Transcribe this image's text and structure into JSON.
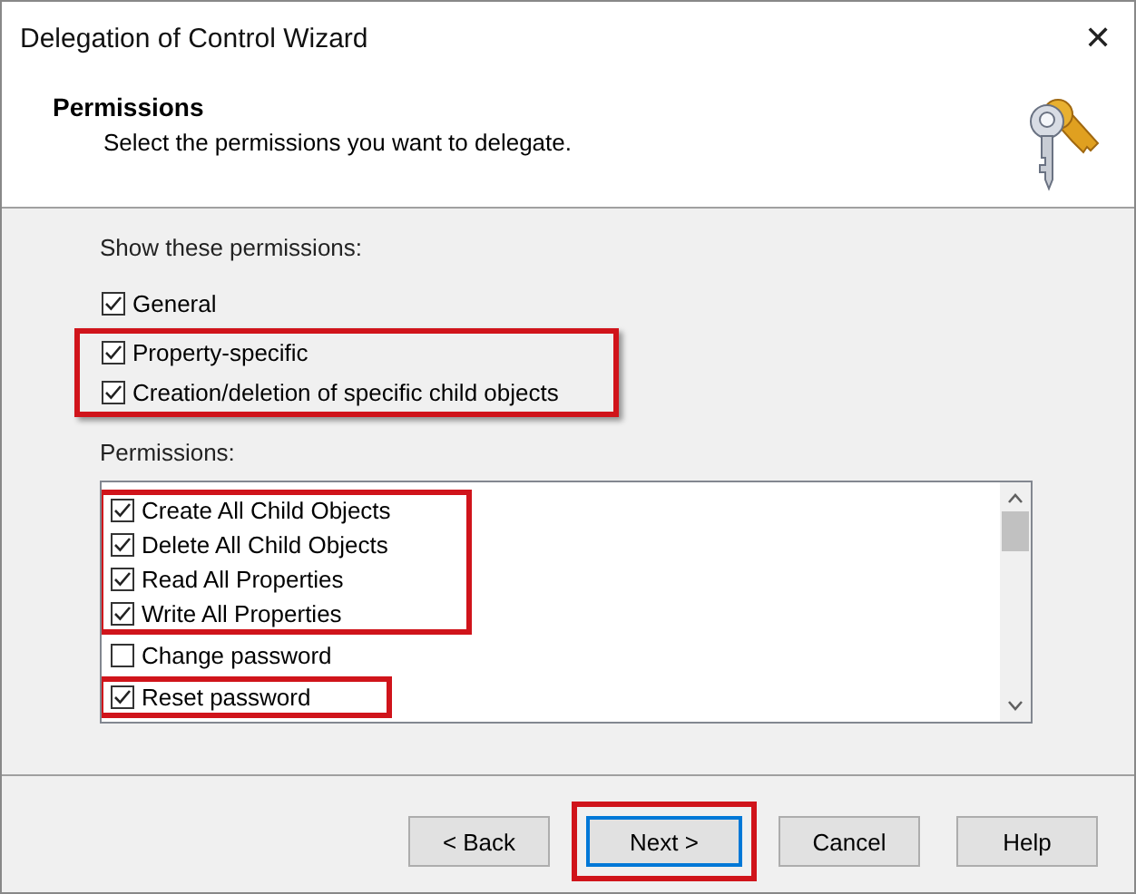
{
  "window": {
    "title": "Delegation of Control Wizard",
    "close": "✕"
  },
  "header": {
    "title": "Permissions",
    "subtitle": "Select the permissions you want to delegate."
  },
  "show_label": "Show these permissions:",
  "show_options": [
    {
      "label": "General",
      "checked": true,
      "highlighted": false
    },
    {
      "label": "Property-specific",
      "checked": true,
      "highlighted": true
    },
    {
      "label": "Creation/deletion of specific child objects",
      "checked": true,
      "highlighted": true
    }
  ],
  "permissions_label": "Permissions:",
  "permissions": [
    {
      "label": "Create All Child Objects",
      "checked": true,
      "highlighted": true
    },
    {
      "label": "Delete All Child Objects",
      "checked": true,
      "highlighted": true
    },
    {
      "label": "Read All Properties",
      "checked": true,
      "highlighted": true
    },
    {
      "label": "Write All Properties",
      "checked": true,
      "highlighted": true
    },
    {
      "label": "Change password",
      "checked": false,
      "highlighted": false
    },
    {
      "label": "Reset password",
      "checked": true,
      "highlighted": true
    }
  ],
  "buttons": [
    {
      "label": "< Back",
      "default": false,
      "highlighted": false
    },
    {
      "label": "Next >",
      "default": true,
      "highlighted": true
    },
    {
      "label": "Cancel",
      "default": false,
      "highlighted": false
    },
    {
      "label": "Help",
      "default": false,
      "highlighted": false
    }
  ]
}
